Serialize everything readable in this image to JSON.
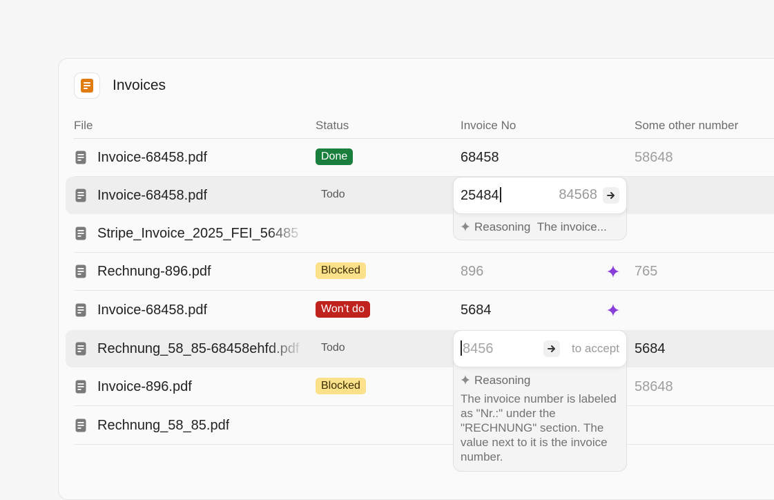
{
  "app": {
    "title": "Invoices",
    "icon": "invoice-doc-icon",
    "accent": "#e07b10"
  },
  "columns": {
    "file": "File",
    "status": "Status",
    "invoice_no": "Invoice No",
    "other": "Some other number"
  },
  "rows": [
    {
      "file": "Invoice-68458.pdf",
      "status": "Done",
      "invoice": "68458",
      "other": "58648"
    },
    {
      "file": "Invoice-68458.pdf",
      "status": "Todo",
      "invoice": "",
      "other": ""
    },
    {
      "file": "Stripe_Invoice_2025_FEI_56485",
      "status": "",
      "invoice": "",
      "other": ""
    },
    {
      "file": "Rechnung-896.pdf",
      "status": "Blocked",
      "invoice": "896",
      "other": "765"
    },
    {
      "file": "Invoice-68458.pdf",
      "status": "Won’t do",
      "invoice": "5684",
      "other": ""
    },
    {
      "file": "Rechnung_58_85-68458ehfd.pdf",
      "status": "Todo",
      "invoice": "",
      "other": "5684"
    },
    {
      "file": "Invoice-896.pdf",
      "status": "Blocked",
      "invoice": "",
      "other": "58648"
    },
    {
      "file": "Rechnung_58_85.pdf",
      "status": "",
      "invoice": "",
      "other": ""
    }
  ],
  "popup1": {
    "value": "25484",
    "suggestion": "84568",
    "reasoning_label": "Reasoning",
    "reasoning_preview": "The invoice..."
  },
  "popup2": {
    "placeholder": "8456",
    "hint": "to accept",
    "reasoning_label": "Reasoning",
    "reasoning_text": "The invoice number is labeled as \"Nr.:\" under the \"RECHNUNG\" section. The value next to it is the invoice number."
  },
  "colors": {
    "done": "#1a7f3c",
    "blocked": "#fbe18a",
    "wont_do": "#c0221d",
    "sparkle": "#8b3fd9"
  }
}
